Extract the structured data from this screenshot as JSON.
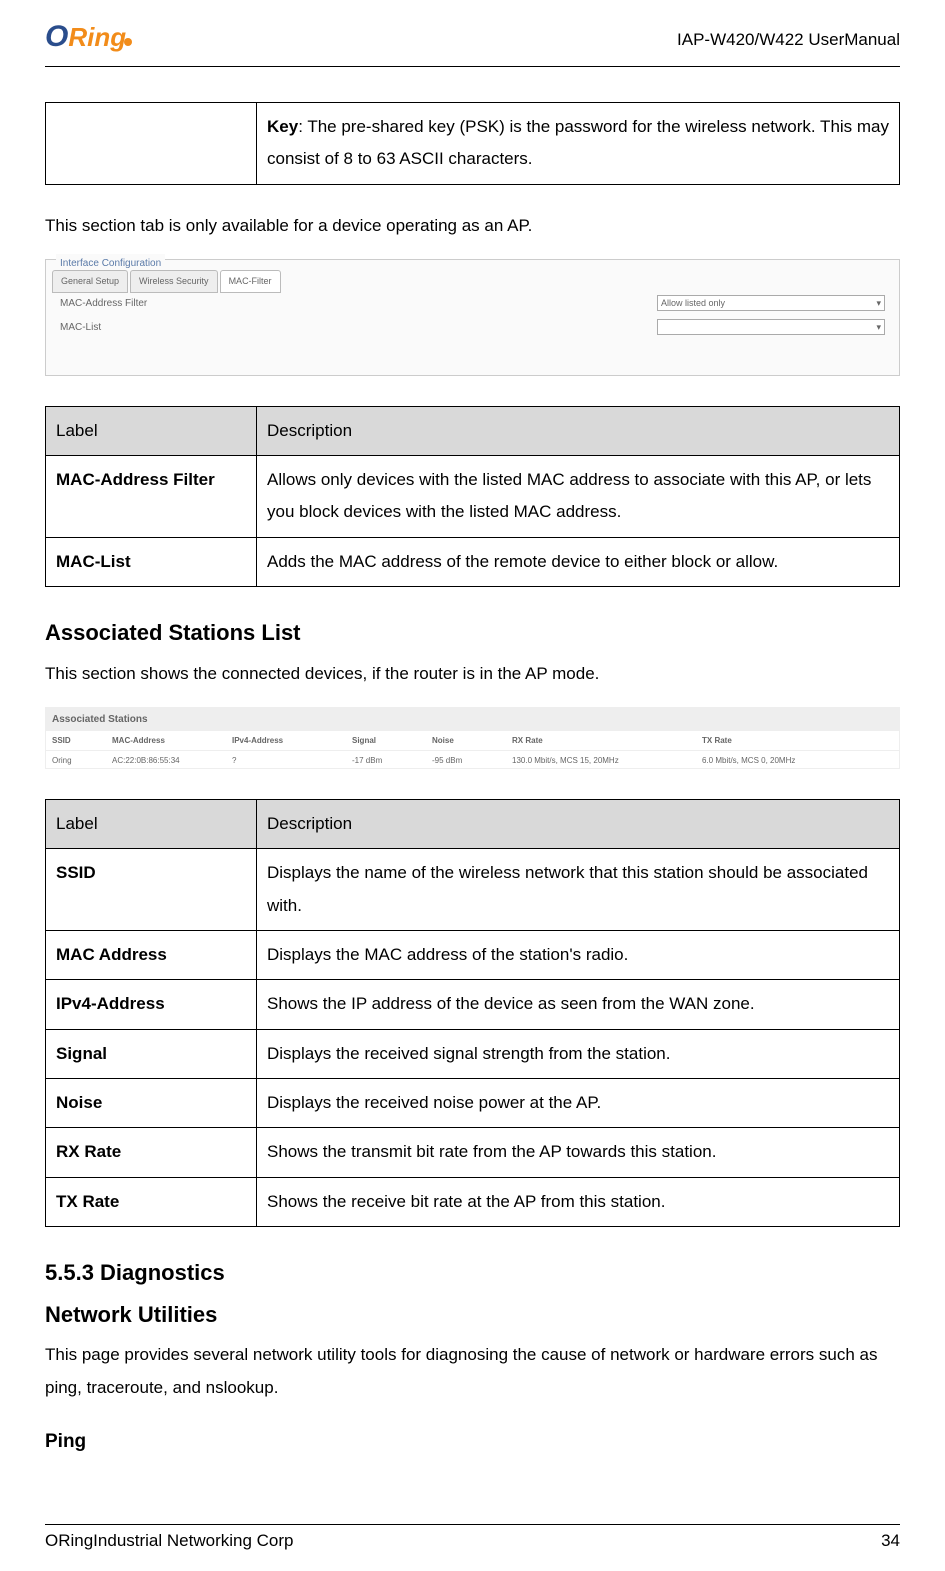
{
  "header": {
    "logo_o": "O",
    "logo_ring": "Ring",
    "doc_title": "IAP-W420/W422  UserManual"
  },
  "key_table": {
    "label": "Key",
    "desc": ": The pre-shared key (PSK) is the password for the wireless network. This may consist of 8 to 63 ASCII characters."
  },
  "note1": "This section tab is only available for a device operating as an AP.",
  "screenshot1": {
    "legend": "Interface Configuration",
    "tabs": [
      "General Setup",
      "Wireless Security",
      "MAC-Filter"
    ],
    "row1_label": "MAC-Address Filter",
    "row1_value": "Allow listed only",
    "row2_label": "MAC-List"
  },
  "mac_table": {
    "h1": "Label",
    "h2": "Description",
    "r1c1": "MAC-Address Filter",
    "r1c2": "Allows only devices with the listed MAC address to associate with this AP, or lets you block devices with the listed MAC address.",
    "r2c1": "MAC-List",
    "r2c2": "Adds the MAC address of the remote device to either block or allow."
  },
  "assoc_heading": "Associated Stations List",
  "assoc_intro": "This section shows the connected devices, if the router is in the AP mode.",
  "assoc_shot": {
    "title": "Associated Stations",
    "headers": [
      "SSID",
      "MAC-Address",
      "IPv4-Address",
      "Signal",
      "Noise",
      "RX Rate",
      "TX Rate"
    ],
    "row": [
      "Oring",
      "AC:22:0B:86:55:34",
      "?",
      "-17 dBm",
      "-95 dBm",
      "130.0 Mbit/s, MCS 15, 20MHz",
      "6.0 Mbit/s, MCS 0, 20MHz"
    ]
  },
  "assoc_table": {
    "h1": "Label",
    "h2": "Description",
    "rows": [
      {
        "c1": "SSID",
        "c2": "Displays the name of the wireless network that this station should be associated with."
      },
      {
        "c1": "MAC Address",
        "c2": "Displays the MAC address of the station's radio."
      },
      {
        "c1": "IPv4-Address",
        "c2": "Shows the IP address of the device as seen from the WAN zone."
      },
      {
        "c1": "Signal",
        "c2": "Displays the received signal strength from the station."
      },
      {
        "c1": "Noise",
        "c2": "Displays the received noise power at the AP."
      },
      {
        "c1": "RX Rate",
        "c2": "Shows the transmit bit rate from the AP towards this station."
      },
      {
        "c1": "TX Rate",
        "c2": "Shows the receive bit rate at the AP from this station."
      }
    ]
  },
  "diag_heading": "5.5.3 Diagnostics",
  "netutil_heading": "Network Utilities",
  "netutil_body": "This page provides several network utility tools for diagnosing the cause of network or hardware errors such as ping, traceroute, and nslookup.",
  "ping_heading": "Ping",
  "footer": {
    "company": "ORingIndustrial Networking Corp",
    "page": "34"
  }
}
